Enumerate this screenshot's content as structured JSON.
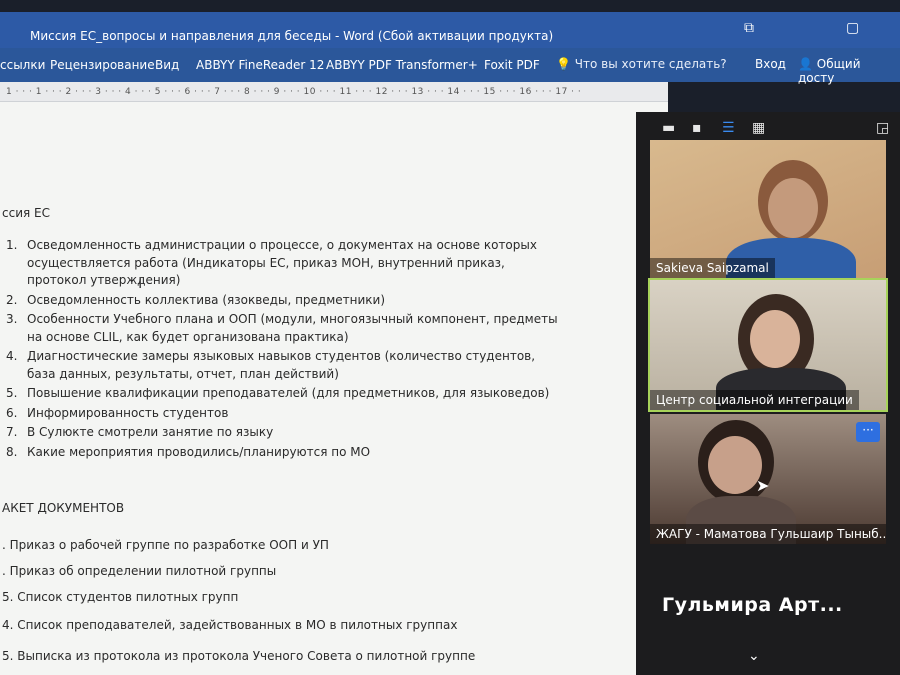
{
  "window": {
    "title": "Миссия ЕС_вопросы и направления для беседы - Word (Сбой активации продукта)",
    "controls": [
      "restore-icon",
      "window-icon"
    ]
  },
  "ribbon": {
    "tabs": [
      "ссылки",
      "Рецензирование",
      "Вид",
      "ABBYY FineReader 12",
      "ABBYY PDF Transformer+",
      "Foxit PDF"
    ],
    "tell_me": "Что вы хотите сделать?",
    "signin": "Вход",
    "share": "Общий досту"
  },
  "ruler": {
    "marks": "1 · · · 1 · · · 2 · · · 3 · · · 4 · · · 5 · · · 6 · · · 7 · · · 8 · · · 9 · · · 10 · · · 11 · · · 12 · · · 13 · · · 14 · · · 15 · · · 16 · · · 17 · ·"
  },
  "document": {
    "heading": "ссия ЕС",
    "items": [
      {
        "num": "1.",
        "text": "Осведомленность администрации о процессе, о документах на основе которых осуществляется работа (Индикаторы ЕС, приказ МОН, внутренний приказ, протокол утверждения)"
      },
      {
        "num": "2.",
        "text": "Осведомленность коллектива (язокведы, предметники)"
      },
      {
        "num": "3.",
        "text": "Особенности Учебного плана и ООП (модули, многоязычный компонент, предметы на основе CLIL, как будет организована практика)"
      },
      {
        "num": "4.",
        "text": "Диагностические замеры языковых навыков студентов (количество студентов, база данных, результаты, отчет, план действий)"
      },
      {
        "num": "5.",
        "text": "Повышение квалификации преподавателей (для предметников, для языковедов)"
      },
      {
        "num": "6.",
        "text": "Информированность студентов"
      },
      {
        "num": "7.",
        "text": "В Сулюкте смотрели занятие по языку"
      },
      {
        "num": "8.",
        "text": "Какие мероприятия проводились/планируются по МО"
      }
    ],
    "package_title": "АКЕТ ДОКУМЕНТОВ",
    "package": [
      ". Приказ о рабочей группе по разработке ООП и УП",
      ". Приказ об определении пилотной группы",
      "5. Список студентов пилотных групп",
      "4. Список преподавателей, задействованных в МО в пилотных группах",
      "5. Выписка из протокола из протокола Ученого Совета о пилотной группе"
    ]
  },
  "zoom": {
    "toolbar_icons": [
      "minimize-icon",
      "hide-icon",
      "speaker-view-icon",
      "gallery-view-icon",
      "exit-fullscreen-icon"
    ],
    "participants": [
      {
        "name": "Sakieva Saipzamal"
      },
      {
        "name": "Центр социальной интеграции"
      },
      {
        "name": "ЖАГУ - Маматова Гульшаир Тыныб..."
      },
      {
        "name": "Гульмира Арт..."
      }
    ],
    "more_label": "···"
  },
  "colors": {
    "titlebar": "#2d5aa6",
    "ribbon": "#2b579a",
    "zoom_bg": "#1c1c1e",
    "active_speaker": "#a7d35a",
    "accent_blue": "#2e6fe0"
  }
}
